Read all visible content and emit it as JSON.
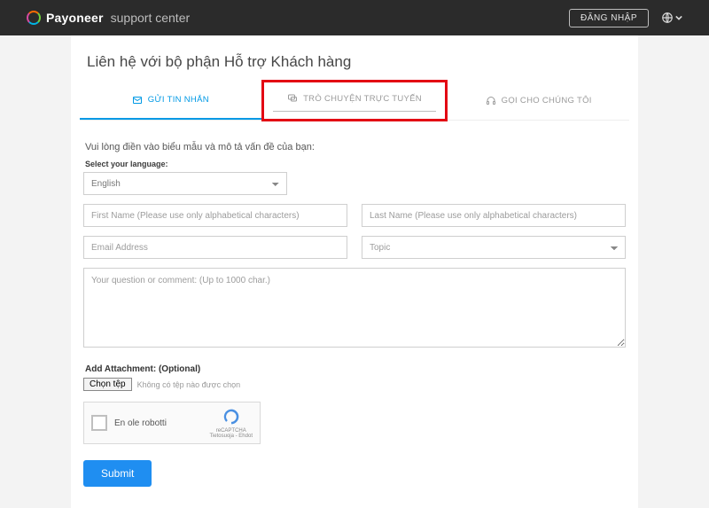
{
  "header": {
    "brand_name": "Payoneer",
    "brand_sub": "support center",
    "login_label": "ĐĂNG NHẬP"
  },
  "page": {
    "title": "Liên hệ với bộ phận Hỗ trợ Khách hàng"
  },
  "tabs": {
    "send_message": "GỬI TIN NHẮN",
    "live_chat": "TRÒ CHUYỆN TRỰC TUYẾN",
    "call_us": "GỌI CHO CHÚNG TÔI"
  },
  "form": {
    "intro": "Vui lòng điền vào biểu mẫu và mô tả vấn đề của bạn:",
    "lang_label": "Select your language:",
    "lang_value": "English",
    "first_name_ph": "First Name (Please use only alphabetical characters)",
    "last_name_ph": "Last Name (Please use only alphabetical characters)",
    "email_ph": "Email Address",
    "topic_ph": "Topic",
    "question_ph": "Your question or comment: (Up to 1000 char.)",
    "attach_label": "Add Attachment: (Optional)",
    "file_button": "Chọn tệp",
    "file_note": "Không có tệp nào được chọn",
    "captcha_text": "En ole robotti",
    "captcha_brand": "reCAPTCHA",
    "captcha_sub": "Tietosuoja - Ehdot",
    "submit": "Submit"
  }
}
